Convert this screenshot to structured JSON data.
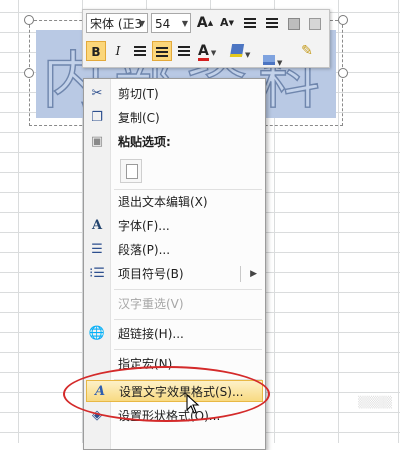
{
  "wordart": {
    "text": "内部资料"
  },
  "mini_toolbar": {
    "font_name": "宋体 (正3",
    "font_size": "54",
    "grow_font": "A",
    "shrink_font": "A",
    "bold": "B",
    "italic": "I",
    "font_color": "A"
  },
  "context_menu": {
    "items": [
      {
        "label": "剪切(T)",
        "icon": "scissors-icon",
        "enabled": true
      },
      {
        "label": "复制(C)",
        "icon": "copy-icon",
        "enabled": true
      },
      {
        "label": "粘贴选项:",
        "icon": "clipboard-icon",
        "enabled": true
      },
      {
        "label": "退出文本编辑(X)",
        "icon": "",
        "enabled": true
      },
      {
        "label": "字体(F)...",
        "icon": "font-icon",
        "enabled": true
      },
      {
        "label": "段落(P)...",
        "icon": "paragraph-icon",
        "enabled": true
      },
      {
        "label": "项目符号(B)",
        "icon": "bullets-icon",
        "enabled": true
      },
      {
        "label": "汉字重选(V)",
        "icon": "",
        "enabled": false
      },
      {
        "label": "超链接(H)...",
        "icon": "hyperlink-icon",
        "enabled": true
      },
      {
        "label": "指定宏(N)...",
        "icon": "",
        "enabled": true
      },
      {
        "label": "设置文字效果格式(S)...",
        "icon": "text-effects-icon",
        "enabled": true
      },
      {
        "label": "设置形状格式(O)...",
        "icon": "shape-format-icon",
        "enabled": true
      }
    ],
    "highlighted_index": 10
  },
  "colors": {
    "highlight": "#f8da82",
    "annotation_oval": "#d42a2a",
    "wordart_fill": "#b9c9e4"
  }
}
